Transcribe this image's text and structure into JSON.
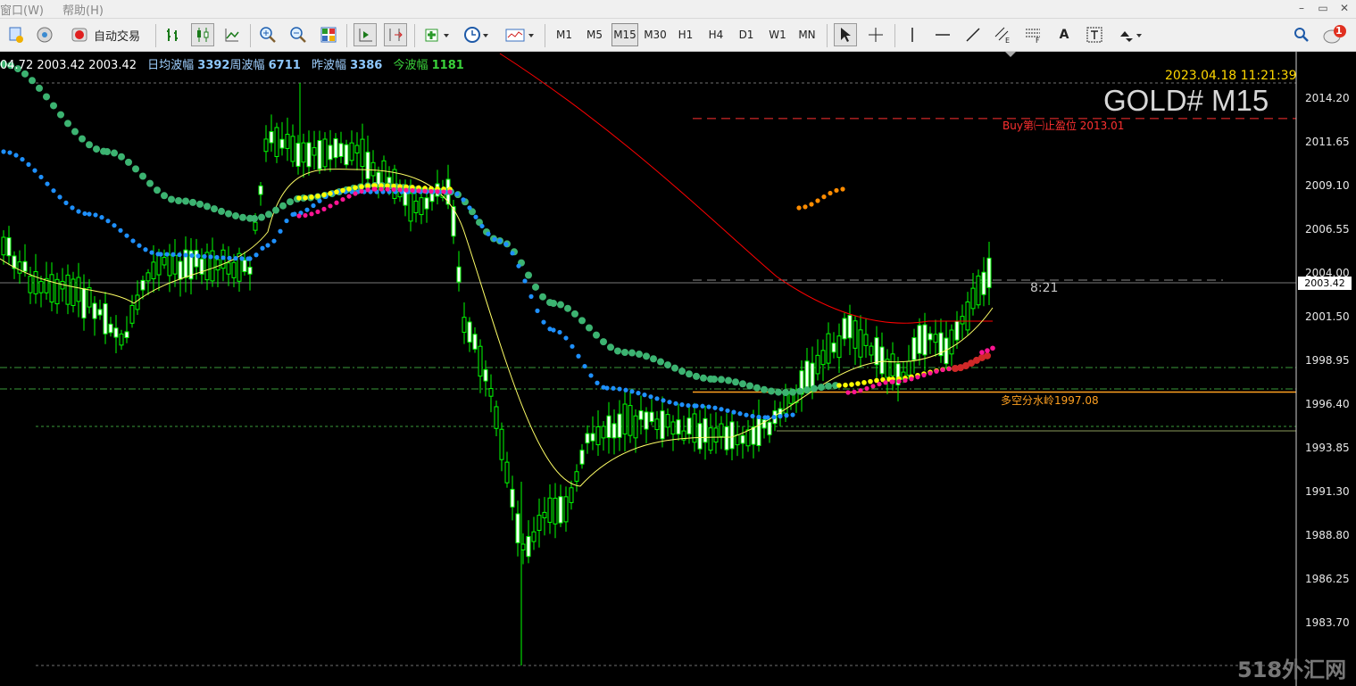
{
  "menu": {
    "items": [
      "窗口(W)",
      "帮助(H)"
    ]
  },
  "window_controls": {
    "minimize": "–",
    "restore": "▭",
    "close": "✕"
  },
  "toolbar": {
    "auto_trade_label": "自动交易",
    "timeframes": [
      "M1",
      "M5",
      "M15",
      "M30",
      "H1",
      "H4",
      "D1",
      "W1",
      "MN"
    ],
    "active_timeframe": "M15",
    "text_tool_label": "A",
    "notification_count": "1"
  },
  "info_bar": {
    "prices": "04.72 2003.42 2003.42",
    "daily_avg_label": "日均波幅",
    "daily_avg_value": "3392",
    "weekly_label": "周波幅",
    "weekly_value": "6711",
    "yesterday_label": "昨波幅",
    "yesterday_value": "3386",
    "today_label": "今波幅",
    "today_value": "1181"
  },
  "chart_header": {
    "datetime": "2023.04.18 11:21:39",
    "symbol": "GOLD# M15"
  },
  "annotations": {
    "stop_line_label": "Buy第㈠止盈位 2013.01",
    "stop_line_price": 2013.01,
    "divide_line_label": "多空分水岭1997.08",
    "divide_line_price": 1997.08,
    "countdown": "8:21"
  },
  "price_axis": {
    "labels": [
      "2014.20",
      "2011.65",
      "2009.10",
      "2006.55",
      "2004.00",
      "2001.50",
      "1998.95",
      "1996.40",
      "1993.85",
      "1991.30",
      "1988.80",
      "1986.25",
      "1983.70"
    ],
    "current_price": "2003.42"
  },
  "colors": {
    "bull": "#00ff00",
    "slow_dots": "#3cb371",
    "fast_dots": "#1e90ff",
    "yellow_dots": "#ffff00",
    "magenta_dots": "#ff1493",
    "ma_red": "#ff0000",
    "ma_yellow": "#ffff66",
    "stop_line": "#ff3030",
    "divide_line": "#ffa020"
  },
  "watermark": "518外汇网"
}
